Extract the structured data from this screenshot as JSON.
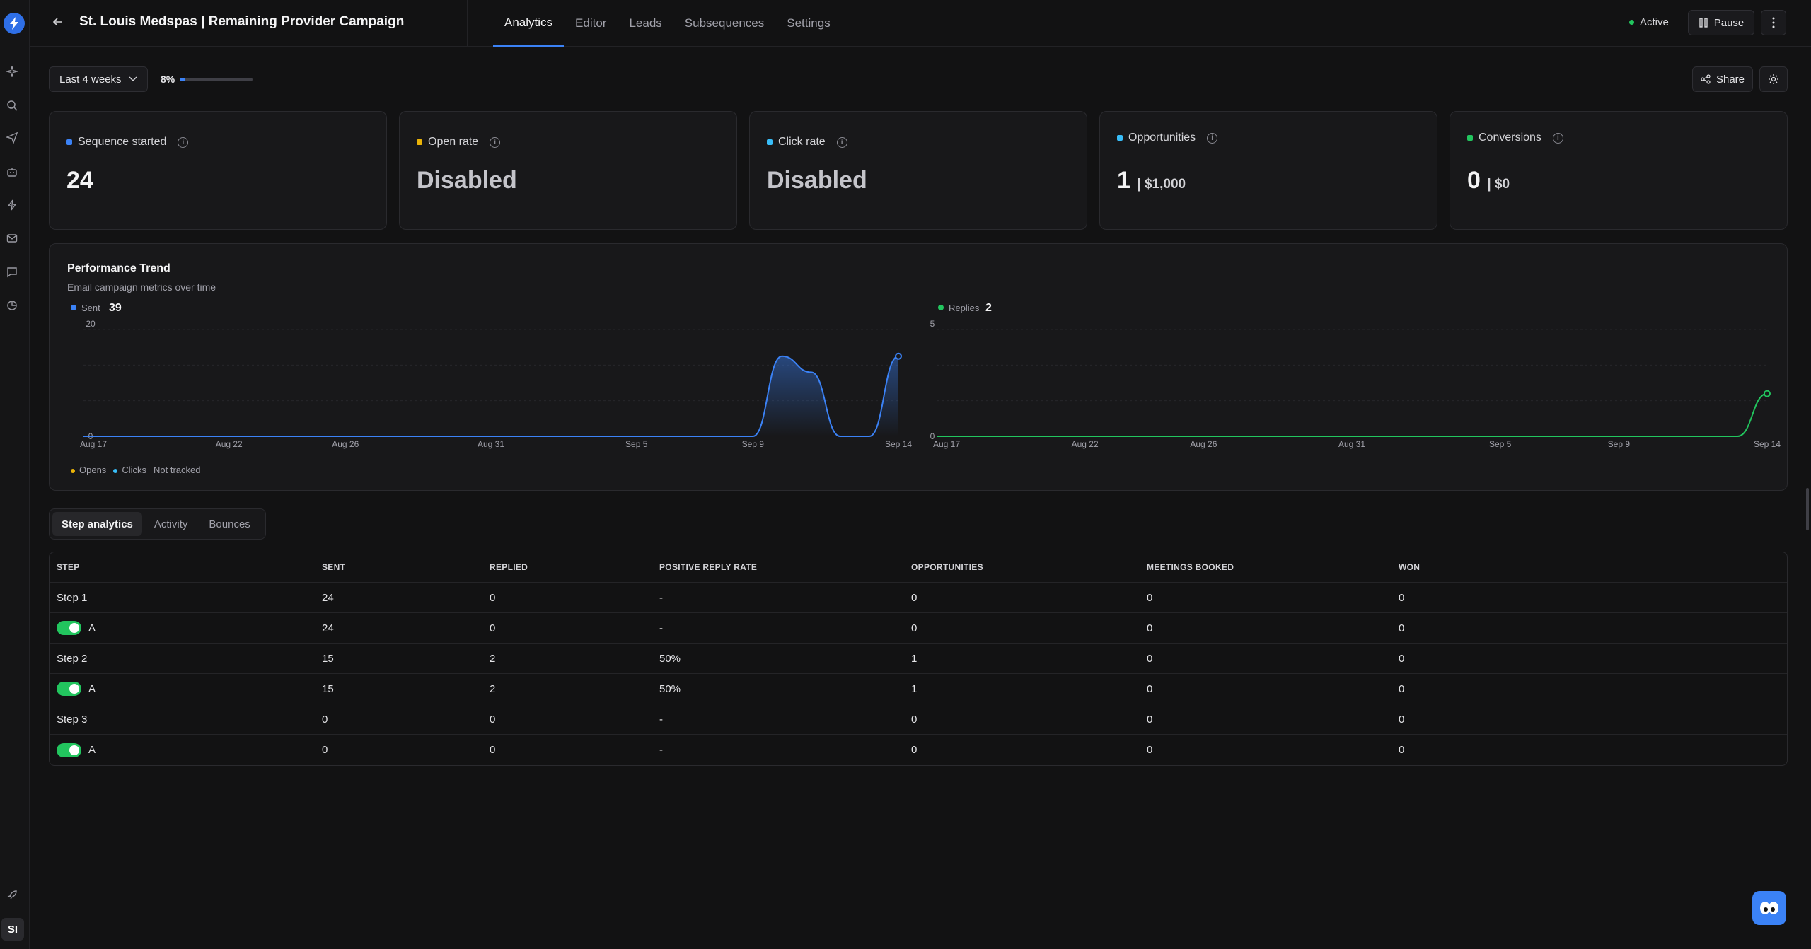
{
  "header": {
    "title": "St. Louis Medspas | Remaining Provider Campaign",
    "tabs": [
      "Analytics",
      "Editor",
      "Leads",
      "Subsequences",
      "Settings"
    ],
    "status": "Active",
    "pause_label": "Pause"
  },
  "filters": {
    "range_label": "Last 4 weeks",
    "progress_label": "8%",
    "progress_value": 0.08,
    "share_label": "Share"
  },
  "cards": [
    {
      "label": "Sequence started",
      "value": "24",
      "color": "#3b82f6"
    },
    {
      "label": "Open rate",
      "value": "Disabled",
      "color": "#eab308"
    },
    {
      "label": "Click rate",
      "value": "Disabled",
      "color": "#38bdf8"
    },
    {
      "label": "Opportunities",
      "value": "1",
      "sub": "| $1,000",
      "color": "#38bdf8"
    },
    {
      "label": "Conversions",
      "value": "0",
      "sub": "| $0",
      "color": "#22c55e"
    }
  ],
  "performance": {
    "title": "Performance Trend",
    "subtitle": "Email campaign metrics over time",
    "legend_opens": "Opens",
    "legend_clicks": "Clicks",
    "legend_note": "Not tracked"
  },
  "chart_data": [
    {
      "type": "area",
      "series": [
        {
          "name": "Sent",
          "total": "39",
          "color": "#3b82f6",
          "values": [
            0,
            0,
            0,
            0,
            0,
            0,
            0,
            0,
            0,
            0,
            0,
            0,
            0,
            0,
            0,
            0,
            0,
            0,
            0,
            0,
            0,
            0,
            0,
            0,
            15,
            12,
            0,
            0,
            15
          ]
        }
      ],
      "x_ticks": [
        "Aug 17",
        "Aug 22",
        "Aug 26",
        "Aug 31",
        "Sep 5",
        "Sep 9",
        "Sep 14"
      ],
      "y_ticks": [
        "20",
        "0"
      ],
      "ylim": [
        0,
        20
      ]
    },
    {
      "type": "line",
      "series": [
        {
          "name": "Replies",
          "total": "2",
          "color": "#22c55e",
          "values": [
            0,
            0,
            0,
            0,
            0,
            0,
            0,
            0,
            0,
            0,
            0,
            0,
            0,
            0,
            0,
            0,
            0,
            0,
            0,
            0,
            0,
            0,
            0,
            0,
            0,
            0,
            0,
            0,
            2
          ]
        }
      ],
      "x_ticks": [
        "Aug 17",
        "Aug 22",
        "Aug 26",
        "Aug 31",
        "Sep 5",
        "Sep 9",
        "Sep 14"
      ],
      "y_ticks": [
        "5",
        "0"
      ],
      "ylim": [
        0,
        5
      ]
    }
  ],
  "subtabs": [
    "Step analytics",
    "Activity",
    "Bounces"
  ],
  "table": {
    "columns": [
      "STEP",
      "SENT",
      "REPLIED",
      "POSITIVE REPLY RATE",
      "OPPORTUNITIES",
      "MEETINGS BOOKED",
      "WON"
    ],
    "rows": [
      {
        "step": "Step 1",
        "toggle": false,
        "cells": [
          "24",
          "0",
          "-",
          "0",
          "0",
          "0"
        ]
      },
      {
        "step": "A",
        "toggle": true,
        "cells": [
          "24",
          "0",
          "-",
          "0",
          "0",
          "0"
        ]
      },
      {
        "step": "Step 2",
        "toggle": false,
        "cells": [
          "15",
          "2",
          "50%",
          "1",
          "0",
          "0"
        ]
      },
      {
        "step": "A",
        "toggle": true,
        "cells": [
          "15",
          "2",
          "50%",
          "1",
          "0",
          "0"
        ]
      },
      {
        "step": "Step 3",
        "toggle": false,
        "cells": [
          "0",
          "0",
          "-",
          "0",
          "0",
          "0"
        ]
      },
      {
        "step": "A",
        "toggle": true,
        "cells": [
          "0",
          "0",
          "-",
          "0",
          "0",
          "0"
        ]
      }
    ]
  },
  "user": {
    "initials": "SI"
  }
}
